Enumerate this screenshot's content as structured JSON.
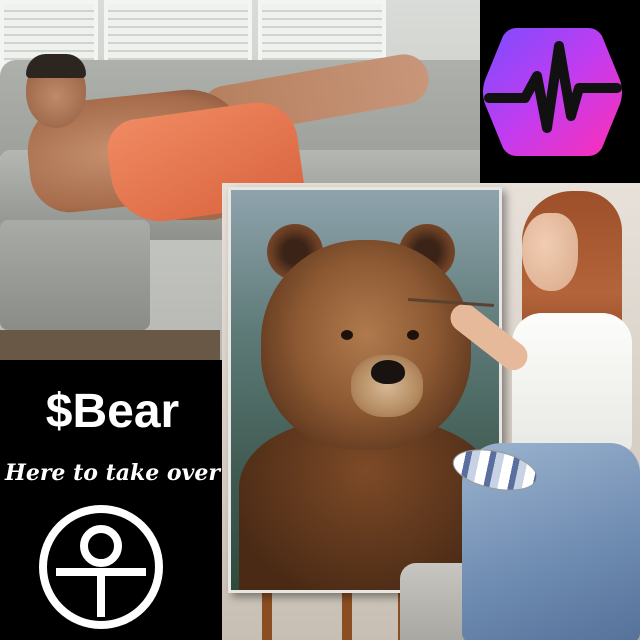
{
  "meme": {
    "ticker": "$Bear",
    "tagline": "Here to take over"
  },
  "app_logo": {
    "icon": "heartbeat-pulse-hexagon-icon",
    "gradient_start": "#7b4dff",
    "gradient_end": "#ff2fb3",
    "stroke_color": "#111111"
  },
  "ot_logo": {
    "icon": "ot-circle-monogram-icon",
    "color": "#ffffff"
  },
  "colors": {
    "background": "#000000",
    "text": "#ffffff",
    "towel": "#e87450",
    "jeans": "#7c98bd"
  }
}
